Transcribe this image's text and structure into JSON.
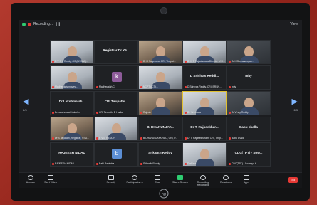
{
  "window": {
    "recording_label": "Recording...",
    "recording_extra": "❙❙",
    "view_label": "View"
  },
  "nav": {
    "left_arrow": "◀",
    "right_arrow": "▶",
    "left_page": "2/3",
    "right_page": "2/3"
  },
  "tiles": [
    {
      "name": "",
      "label": "R V S K Reddy, OS (NYSBA)...",
      "style": "video light"
    },
    {
      "name": "Registrar Dr Y5...",
      "label": "",
      "style": "plain"
    },
    {
      "name": "",
      "label": "Dr R Nagendra, CRI, Tirupat...",
      "style": "video warm"
    },
    {
      "name": "",
      "label": "Dr K S Rajashekara Director of R...",
      "style": "video light"
    },
    {
      "name": "",
      "label": "Dr K Suryanarayan...",
      "style": "video dark"
    },
    {
      "name": "",
      "label": "Madhavikrishnavey...",
      "style": "video light"
    },
    {
      "name": "",
      "label": "Madhavaiah C",
      "style": "avatar",
      "avatar_letter": "k",
      "avatar_color": "#8e5b9a"
    },
    {
      "name": "",
      "label": "NCPT (ICT)...",
      "style": "video light"
    },
    {
      "name": "D Srinivas Reddi...",
      "label": "D Srinivas Reddy, CRI, BRSN...",
      "style": "plain"
    },
    {
      "name": "mlty",
      "label": "mlty",
      "style": "plain"
    },
    {
      "name": "Dr.Lakshmaiah...",
      "label": "Dr.Lakshmaiah Lakshmi",
      "style": "plain"
    },
    {
      "name": "CRI Tirupathi...",
      "label": "CRI Tirupathi D Harika",
      "style": "plain"
    },
    {
      "name": "",
      "label": "Rajesh",
      "style": "video warm"
    },
    {
      "name": "",
      "label": "Dr. Srinivasa",
      "style": "video light",
      "active": true
    },
    {
      "name": "",
      "label": "Dr Vinay Reddy",
      "style": "video dark"
    },
    {
      "name": "",
      "label": "Dr S Jayaram, Registrar, VSU...",
      "style": "video warm"
    },
    {
      "name": "",
      "label": "K V M REDDY",
      "style": "video light"
    },
    {
      "name": "B. DHANUNJAY...",
      "label": "B DHANUNJAYA RAO, CRI, P...",
      "style": "plain"
    },
    {
      "name": "Dr T. Rajasekhar...",
      "label": "Dr T. Rajasekharam, CRI, Tirup...",
      "style": "plain"
    },
    {
      "name": "Babu challa",
      "label": "Babu challa",
      "style": "plain"
    },
    {
      "name": "RAJEESH NIDAD",
      "label": "RAJEESH NIDAD",
      "style": "plain"
    },
    {
      "name": "",
      "label": "Babi Ravindra",
      "style": "avatar",
      "avatar_letter": "b",
      "avatar_color": "#5c8fd6"
    },
    {
      "name": "Srikanth Reddy",
      "label": "Srikanth Reddy",
      "style": "plain"
    },
    {
      "name": "",
      "label": "DrsRavi",
      "style": "video light"
    },
    {
      "name": "CDC(TPT) - Sow...",
      "label": "CDC(TPT) - Sowmya K",
      "style": "plain"
    }
  ],
  "toolbar": {
    "unmute": "Unmute",
    "start_video": "Start Video",
    "security": "Security",
    "participants": "Participants",
    "participants_count": "75",
    "chat": "Chat",
    "share_screen": "Share Screen",
    "recording": "Recording Recording",
    "reactions": "Reactions",
    "apps": "Apps",
    "end": "End"
  },
  "colors": {
    "accent_green": "#2ecc71",
    "end_red": "#e53935",
    "active_speaker": "#e0c030"
  }
}
